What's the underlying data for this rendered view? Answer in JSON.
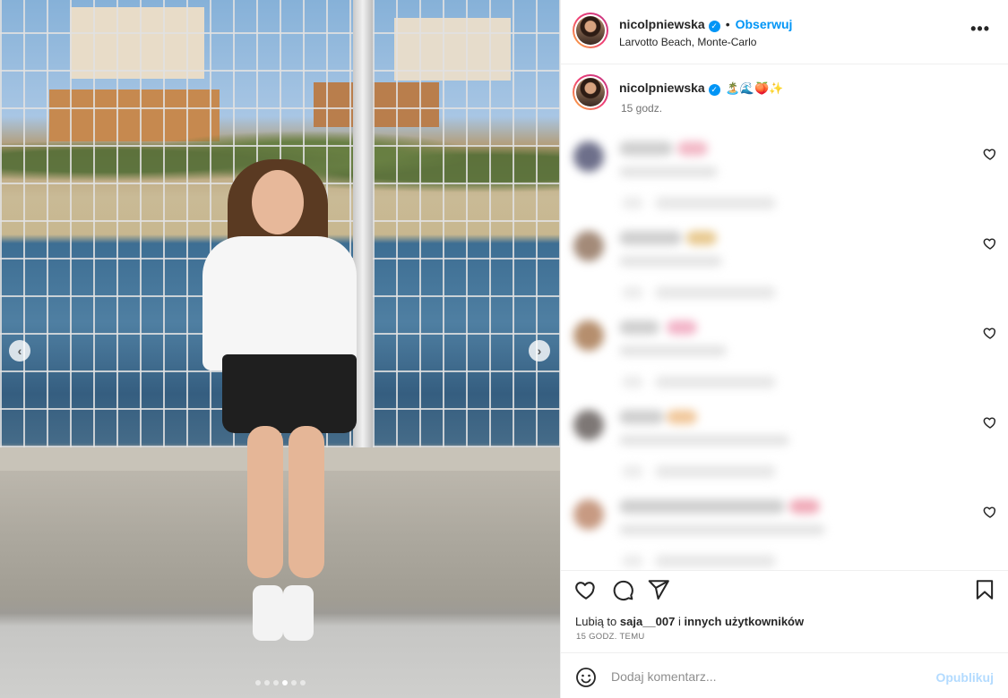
{
  "post": {
    "username": "nicolpniewska",
    "separator": "•",
    "follow_label": "Obserwuj",
    "location": "Larvotto Beach, Monte-Carlo",
    "more_label": "•••"
  },
  "caption": {
    "username": "nicolpniewska",
    "emojis": "🏝️🌊🍑✨",
    "time": "15 godz."
  },
  "comments_note": "blurred",
  "comments": [
    {
      "emoji_color": "#f2b8c6"
    },
    {
      "emoji_color": "#e8c98f"
    },
    {
      "emoji_color": "#f2b3c7"
    },
    {
      "emoji_color": "#f1c79a"
    },
    {
      "emoji_color": "#f0aab8"
    }
  ],
  "likes": {
    "prefix": "Lubią to",
    "user": "saja__007",
    "middle": "i",
    "others": "innych użytkowników"
  },
  "posted_ago": "15 GODZ. TEMU",
  "add_comment": {
    "placeholder": "Dodaj komentarz...",
    "publish_label": "Opublikuj"
  },
  "carousel": {
    "slide_count": 6,
    "active_index": 3,
    "prev_symbol": "‹",
    "next_symbol": "›"
  },
  "colors": {
    "accent": "#0095f6",
    "publish_disabled": "#b3dbff",
    "text": "#262626",
    "muted": "#737373"
  }
}
